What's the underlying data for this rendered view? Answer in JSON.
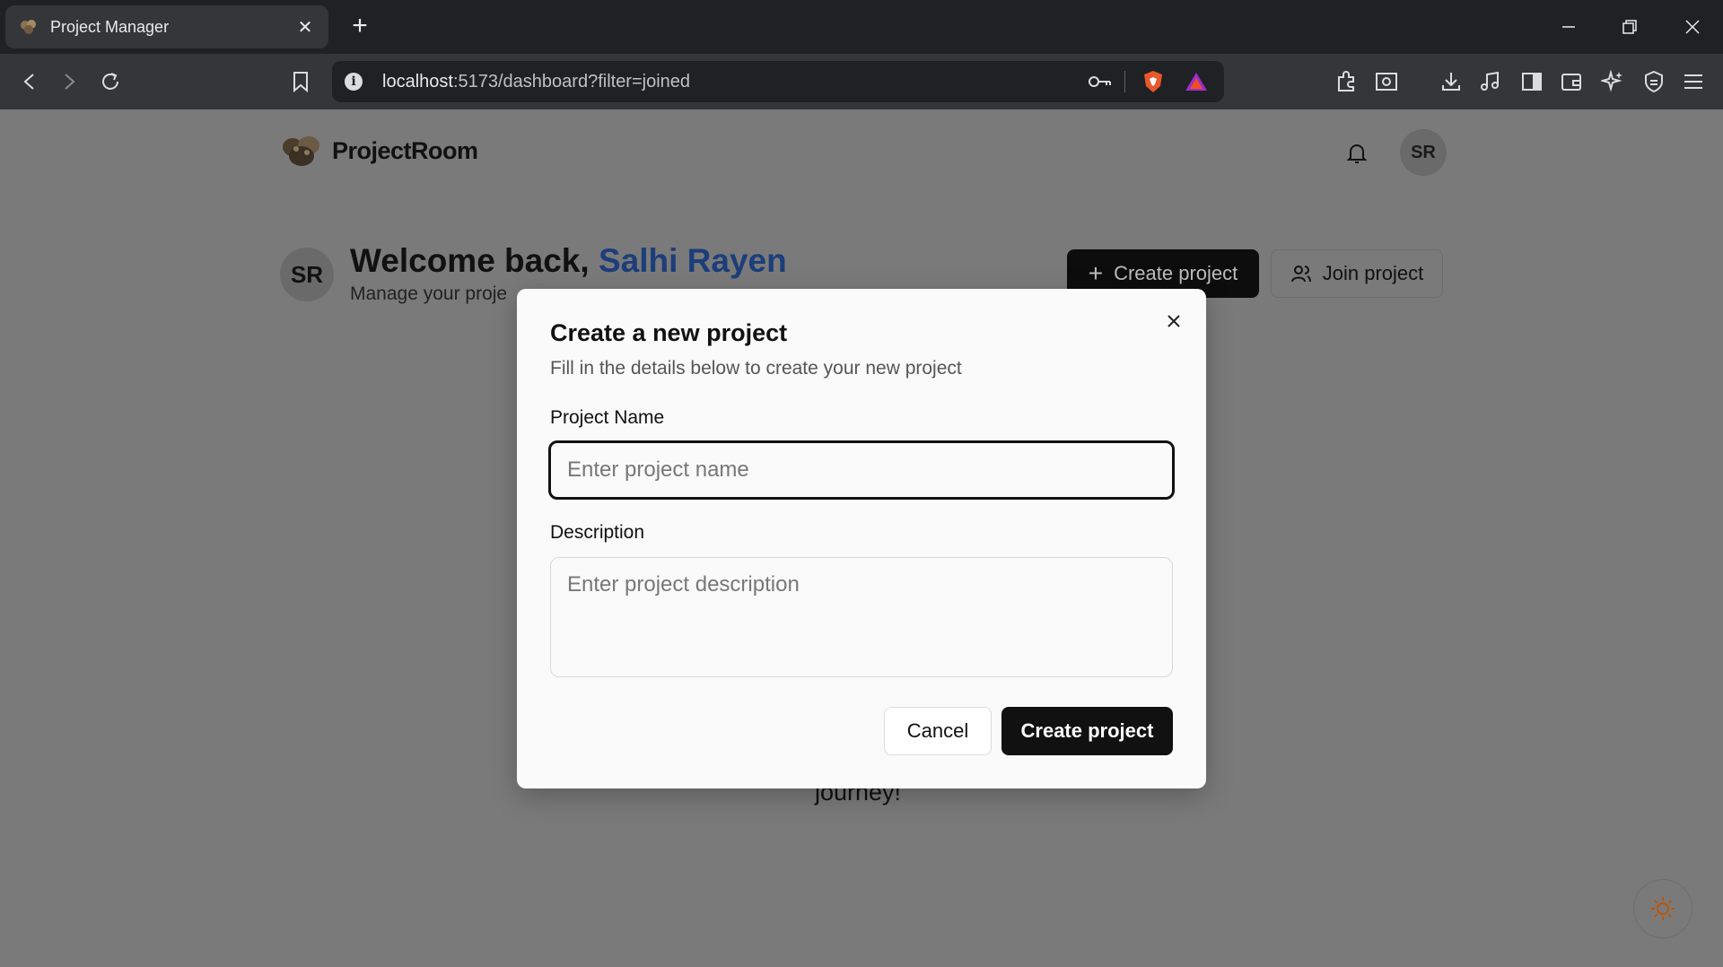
{
  "browser": {
    "tab_title": "Project Manager",
    "url_host": "localhost",
    "url_rest": ":5173/dashboard?filter=joined",
    "icons": [
      "back-icon",
      "forward-icon",
      "reload-icon",
      "bookmark-icon",
      "info-icon",
      "key-icon",
      "brave-shield-icon",
      "brave-rewards-icon",
      "extensions-icon",
      "screenshot-icon",
      "download-icon",
      "media-icon",
      "sidebar-icon",
      "wallet-icon",
      "leo-ai-icon",
      "vpn-icon",
      "menu-icon"
    ]
  },
  "header": {
    "brand_name": "ProjectRoom",
    "avatar_initials": "SR"
  },
  "welcome": {
    "avatar_initials": "SR",
    "greeting": "Welcome back, ",
    "user_name": "Salhi Rayen",
    "subtitle": "Manage your proje"
  },
  "actions": {
    "create_label": "Create project",
    "join_label": "Join project"
  },
  "background": {
    "journey_text": "journey!"
  },
  "modal": {
    "title": "Create a new project",
    "description": "Fill in the details below to create your new project",
    "name_label": "Project Name",
    "name_placeholder": "Enter project name",
    "name_value": "",
    "description_label": "Description",
    "description_placeholder": "Enter project description",
    "description_value": "",
    "cancel_label": "Cancel",
    "submit_label": "Create project"
  },
  "colors": {
    "accent_name": "#1c3e7a",
    "primary_button": "#111111",
    "overlay": "#7a7a7a"
  }
}
